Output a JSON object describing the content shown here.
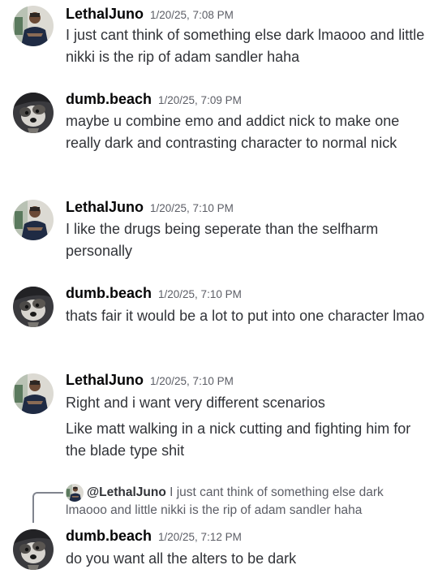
{
  "messages": [
    {
      "username": "LethalJuno",
      "timestamp": "1/20/25, 7:08 PM",
      "avatar_icon": "juno-avatar",
      "lines": [
        "I just cant think of something else dark lmaooo and little nikki is the rip of adam sandler haha"
      ]
    },
    {
      "username": "dumb.beach",
      "timestamp": "1/20/25, 7:09 PM",
      "avatar_icon": "dog-avatar",
      "lines": [
        "maybe u combine emo and addict nick to make one really dark and contrasting character to normal nick"
      ]
    },
    {
      "username": "LethalJuno",
      "timestamp": "1/20/25, 7:10 PM",
      "avatar_icon": "juno-avatar",
      "lines": [
        "I like the drugs being seperate than the selfharm personally"
      ]
    },
    {
      "username": "dumb.beach",
      "timestamp": "1/20/25, 7:10 PM",
      "avatar_icon": "dog-avatar",
      "lines": [
        "thats fair it would be a lot to put into one character lmao"
      ]
    },
    {
      "username": "LethalJuno",
      "timestamp": "1/20/25, 7:10 PM",
      "avatar_icon": "juno-avatar",
      "lines": [
        "Right and i want very different scenarios",
        "Like matt walking in a nick cutting and fighting him for the blade type shit"
      ]
    },
    {
      "username": "dumb.beach",
      "timestamp": "1/20/25, 7:12 PM",
      "avatar_icon": "dog-avatar",
      "reply": {
        "mention": "@LethalJuno",
        "text": "I just cant think of something else dark lmaooo and little nikki is the rip of adam sandler haha"
      },
      "lines": [
        "do you want all the alters to be dark"
      ]
    }
  ]
}
